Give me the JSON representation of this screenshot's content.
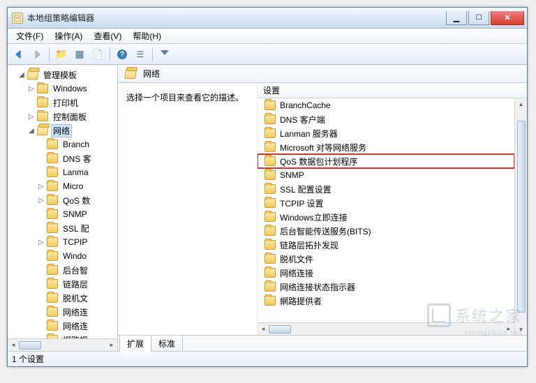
{
  "window": {
    "title": "本地组策略编辑器"
  },
  "menubar": {
    "items": [
      "文件(F)",
      "操作(A)",
      "查看(V)",
      "帮助(H)"
    ]
  },
  "tree": {
    "root": {
      "label": "管理模板",
      "expanded": true
    },
    "children": [
      {
        "label": "Windows",
        "expandable": true
      },
      {
        "label": "打印机",
        "expandable": false
      },
      {
        "label": "控制面板",
        "expandable": true
      },
      {
        "label": "网络",
        "expandable": true,
        "selected": true,
        "expanded": true,
        "children": [
          {
            "label": "Branch",
            "truncated": true
          },
          {
            "label": "DNS 客",
            "truncated": true
          },
          {
            "label": "Lanma",
            "truncated": true
          },
          {
            "label": "Micro",
            "truncated": true,
            "expandable": true
          },
          {
            "label": "QoS 数",
            "truncated": true,
            "expandable": true
          },
          {
            "label": "SNMP",
            "truncated": true
          },
          {
            "label": "SSL 配",
            "truncated": true
          },
          {
            "label": "TCPIP",
            "truncated": true,
            "expandable": true
          },
          {
            "label": "Windo",
            "truncated": true
          },
          {
            "label": "后台智",
            "truncated": true
          },
          {
            "label": "链路层",
            "truncated": true
          },
          {
            "label": "脱机文",
            "truncated": true
          },
          {
            "label": "网络连",
            "truncated": true
          },
          {
            "label": "网络连",
            "truncated": true
          },
          {
            "label": "網路提",
            "truncated": true
          }
        ]
      }
    ]
  },
  "right": {
    "header_title": "网络",
    "description": "选择一个项目来查看它的描述。",
    "col_setting": "设置",
    "items": [
      {
        "label": "BranchCache"
      },
      {
        "label": "DNS 客户端"
      },
      {
        "label": "Lanman 服务器"
      },
      {
        "label": "Microsoft 对等网络服务"
      },
      {
        "label": "QoS 数据包计划程序",
        "highlight": true
      },
      {
        "label": "SNMP"
      },
      {
        "label": "SSL 配置设置"
      },
      {
        "label": "TCPIP 设置"
      },
      {
        "label": "Windows立即连接"
      },
      {
        "label": "后台智能传送服务(BITS)"
      },
      {
        "label": "链路层拓扑发现"
      },
      {
        "label": "脱机文件"
      },
      {
        "label": "网络连接"
      },
      {
        "label": "网络连接状态指示器"
      },
      {
        "label": "網路提供者"
      }
    ],
    "tabs": {
      "extended": "扩展",
      "standard": "标准"
    }
  },
  "statusbar": {
    "text": "1 个设置"
  },
  "watermark": {
    "brand": "系统之家",
    "url": "xitongzhijia.net"
  }
}
